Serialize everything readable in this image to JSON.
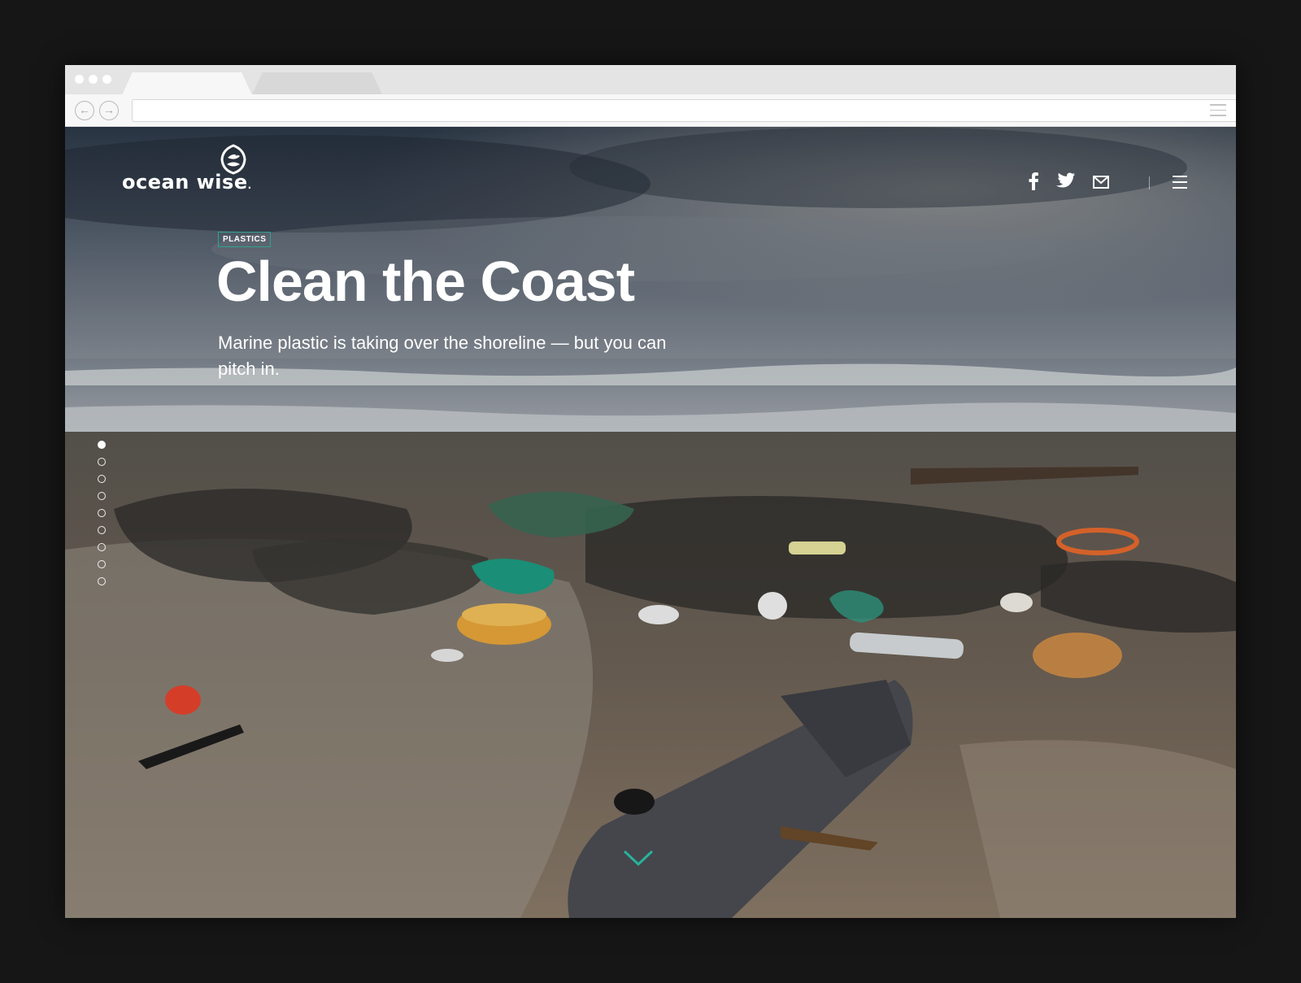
{
  "brand": {
    "logo_text": "ocean wise",
    "registered": "."
  },
  "header": {
    "social": [
      "facebook-icon",
      "twitter-icon",
      "mail-icon"
    ],
    "menu_icon": "hamburger-menu-icon"
  },
  "hero": {
    "tag": "PLASTICS",
    "title": "Clean the Coast",
    "subtitle": "Marine plastic is taking over the shoreline — but you can pitch in."
  },
  "pager": {
    "count": 9,
    "active_index": 0
  },
  "colors": {
    "accent": "#2fa48e",
    "scroll_chevron": "#27b39c"
  }
}
